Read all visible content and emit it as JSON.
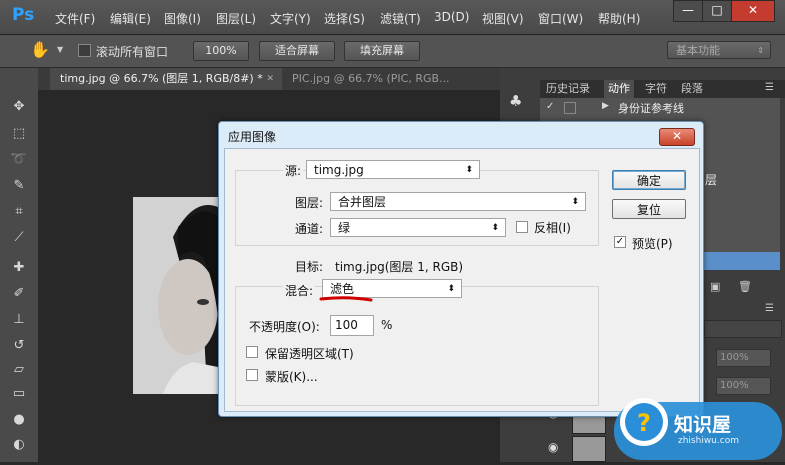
{
  "app": {
    "logo": "Ps"
  },
  "menubar": {
    "items": [
      "文件(F)",
      "编辑(E)",
      "图像(I)",
      "图层(L)",
      "文字(Y)",
      "选择(S)",
      "滤镜(T)",
      "3D(D)",
      "视图(V)",
      "窗口(W)",
      "帮助(H)"
    ]
  },
  "window_controls": {
    "minimize": "—",
    "maximize": "□",
    "close": "✕"
  },
  "options_bar": {
    "scroll_all_label": "滚动所有窗口",
    "zoom_button": "100%",
    "fit_screen_button": "适合屏幕",
    "fill_screen_button": "填充屏幕",
    "workspace": "基本功能"
  },
  "doc_tabs": [
    {
      "label": "timg.jpg @ 66.7% (图层 1, RGB/8#) *",
      "close": "✕"
    },
    {
      "label": "PIC.jpg @ 66.7% (PIC, RGB..."
    }
  ],
  "panel_tabs": [
    "历史记录",
    "动作",
    "字符",
    "段落"
  ],
  "panel_list": {
    "row1": "身份证参考线"
  },
  "panel_fragment": "层",
  "layers_panel": {
    "opacity1": "100%",
    "opacity2": "100%"
  },
  "dialog": {
    "title": "应用图像",
    "close": "✕",
    "source_label": "源:",
    "source_value": "timg.jpg",
    "layer_label": "图层:",
    "layer_value": "合并图层",
    "channel_label": "通道:",
    "channel_value": "绿",
    "invert_label": "反相(I)",
    "target_label": "目标:",
    "target_value": "timg.jpg(图层 1, RGB)",
    "blend_label": "混合:",
    "blend_value": "滤色",
    "opacity_label": "不透明度(O):",
    "opacity_value": "100",
    "opacity_unit": "%",
    "preserve_transparency_label": "保留透明区域(T)",
    "mask_label": "蒙版(K)...",
    "ok_button": "确定",
    "reset_button": "复位",
    "preview_label": "预览(P)",
    "preview_checked": true
  },
  "watermark": {
    "text_cn": "知识屋",
    "text_en": "zhishiwu.com"
  },
  "colors": {
    "accent_red": "#d00000",
    "watermark_blue": "#2a8fd8"
  }
}
